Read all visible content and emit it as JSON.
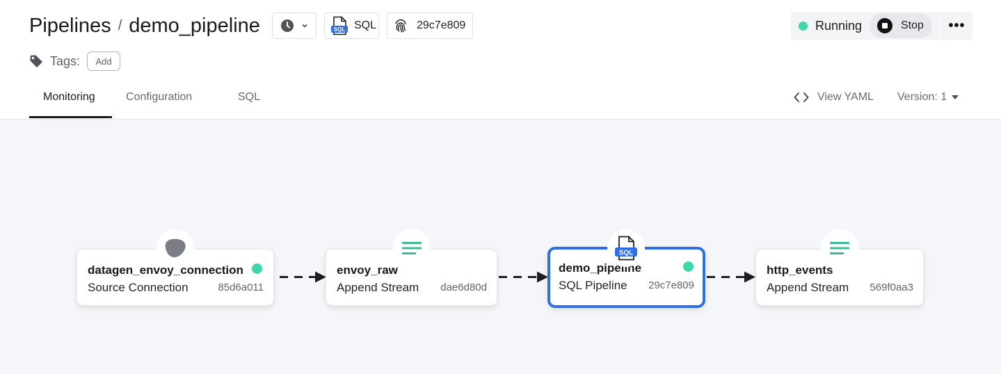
{
  "breadcrumb": {
    "root": "Pipelines",
    "separator": "/",
    "current": "demo_pipeline"
  },
  "header": {
    "history_icon": "clock-icon",
    "sql_label": "SQL",
    "hash": "29c7e809",
    "status": "Running",
    "stop_label": "Stop",
    "more_label": "•••"
  },
  "tags": {
    "label": "Tags:",
    "add_label": "Add"
  },
  "tabs": [
    {
      "label": "Monitoring",
      "active": true
    },
    {
      "label": "Configuration",
      "active": false
    },
    {
      "label": "SQL",
      "active": false
    }
  ],
  "toolbar": {
    "view_yaml_label": "View YAML",
    "version_label": "Version: 1"
  },
  "colors": {
    "accent": "#2f6fe4",
    "status_green": "#3fd6ab",
    "stream_icon": "#3fb993",
    "canvas_bg": "#f4f6f9"
  },
  "nodes": [
    {
      "title": "datagen_envoy_connection",
      "subtitle": "Source Connection",
      "id": "85d6a011",
      "status_dot": true,
      "icon": "connection-icon",
      "selected": false
    },
    {
      "title": "envoy_raw",
      "subtitle": "Append Stream",
      "id": "dae6d80d",
      "status_dot": false,
      "icon": "stream-icon",
      "selected": false
    },
    {
      "title": "demo_pipeline",
      "subtitle": "SQL Pipeline",
      "id": "29c7e809",
      "status_dot": true,
      "icon": "sql-file-icon",
      "selected": true
    },
    {
      "title": "http_events",
      "subtitle": "Append Stream",
      "id": "569f0aa3",
      "status_dot": false,
      "icon": "stream-icon",
      "selected": false
    }
  ]
}
